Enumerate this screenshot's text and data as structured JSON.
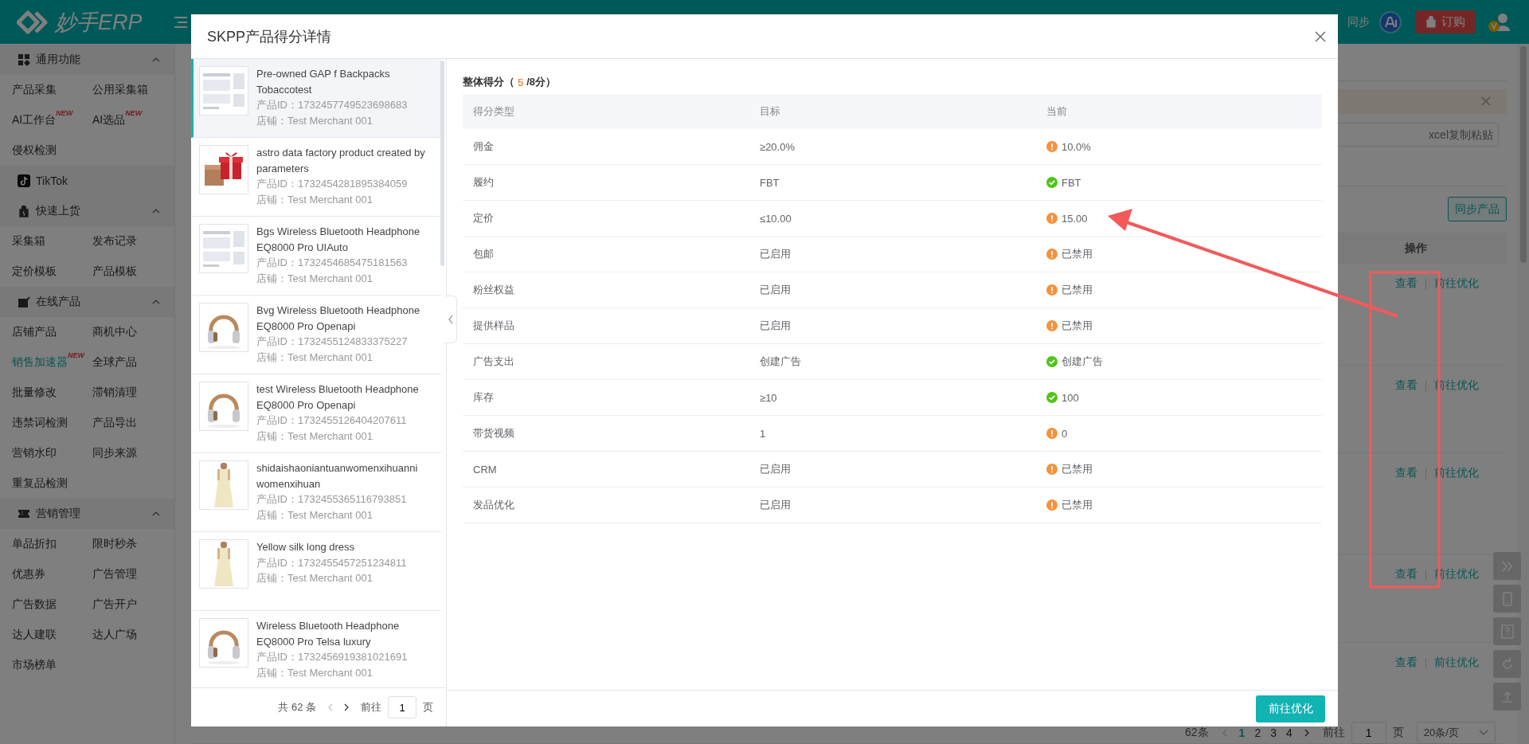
{
  "topbar": {
    "logo": "妙手ERP",
    "sync": "同步",
    "order_button": "订购"
  },
  "sidebar": {
    "sections": [
      {
        "title": "通用功能",
        "expanded": true,
        "items": [
          {
            "label": "产品采集",
            "selected": false
          },
          {
            "label": "公用采集箱",
            "selected": false
          },
          {
            "label": "AI工作台",
            "selected": false,
            "badge": "NEW"
          },
          {
            "label": "AI选品",
            "selected": false,
            "badge": "NEW"
          },
          {
            "label": "侵权检测",
            "selected": false
          }
        ]
      },
      {
        "title": "TikTok"
      },
      {
        "title": "快速上货",
        "expanded": true,
        "items": [
          {
            "label": "采集箱",
            "selected": false
          },
          {
            "label": "发布记录",
            "selected": false
          },
          {
            "label": "定价模板",
            "selected": false
          },
          {
            "label": "产品模板",
            "selected": false
          }
        ]
      },
      {
        "title": "在线产品",
        "expanded": true,
        "items": [
          {
            "label": "店铺产品",
            "selected": false
          },
          {
            "label": "商机中心",
            "selected": false
          },
          {
            "label": "销售加速器",
            "selected": true,
            "badge": "NEW"
          },
          {
            "label": "全球产品",
            "selected": false
          },
          {
            "label": "批量修改",
            "selected": false
          },
          {
            "label": "滞销清理",
            "selected": false
          },
          {
            "label": "违禁词检测",
            "selected": false
          },
          {
            "label": "产品导出",
            "selected": false
          },
          {
            "label": "营销水印",
            "selected": false
          },
          {
            "label": "同步来源",
            "selected": false
          },
          {
            "label": "重复品检测",
            "selected": false
          }
        ]
      },
      {
        "title": "营销管理",
        "expanded": true,
        "items": [
          {
            "label": "单品折扣",
            "selected": false
          },
          {
            "label": "限时秒杀",
            "selected": false
          },
          {
            "label": "优惠券",
            "selected": false
          },
          {
            "label": "广告管理",
            "selected": false
          },
          {
            "label": "广告数据",
            "selected": false
          },
          {
            "label": "广告开户",
            "selected": false
          },
          {
            "label": "达人建联",
            "selected": false
          },
          {
            "label": "达人广场",
            "selected": false
          },
          {
            "label": "市场榜单",
            "selected": false
          }
        ]
      }
    ]
  },
  "page": {
    "search_placeholder": "xcel复制粘贴",
    "sync_products_button": "同步产品",
    "action_column": "操作",
    "rows": [
      {
        "actions": [
          "查看",
          "前往优化"
        ]
      },
      {
        "actions": [
          "查看",
          "前往优化"
        ]
      },
      {
        "actions": [
          "查看",
          "前往优化"
        ]
      },
      {
        "actions": [
          "查看",
          "前往优化"
        ]
      },
      {
        "actions": [
          "查看",
          "前往优化"
        ]
      }
    ],
    "pagination": {
      "total": "62条",
      "pages": [
        {
          "label": "1",
          "selected": true
        },
        {
          "label": "2",
          "selected": false
        },
        {
          "label": "3",
          "selected": false
        },
        {
          "label": "4",
          "selected": false
        }
      ],
      "goto": "前往",
      "page_input": "1",
      "page_unit": "页",
      "page_size": "20条/页"
    }
  },
  "modal": {
    "title": "SKPP产品得分详情",
    "products": [
      {
        "name": "Pre-owned GAP f Backpacks Tobaccotest",
        "id": "产品ID：1732457749523698683",
        "shop": "店铺：Test Merchant 001",
        "selected": true
      },
      {
        "name": "astro data factory product created by parameters",
        "id": "产品ID：1732454281895384059",
        "shop": "店铺：Test Merchant 001",
        "selected": false
      },
      {
        "name": "Bgs Wireless Bluetooth Headphone EQ8000 Pro UIAuto",
        "id": "产品ID：1732454685475181563",
        "shop": "店铺：Test Merchant 001",
        "selected": false
      },
      {
        "name": "Bvg Wireless Bluetooth Headphone EQ8000 Pro Openapi",
        "id": "产品ID：1732455124833375227",
        "shop": "店铺：Test Merchant 001",
        "selected": false
      },
      {
        "name": "test Wireless Bluetooth Headphone EQ8000 Pro Openapi",
        "id": "产品ID：1732455126404207611",
        "shop": "店铺：Test Merchant 001",
        "selected": false
      },
      {
        "name": "shidaishaoniantuanwomenxihuanni womenxihuan",
        "id": "产品ID：1732455365116793851",
        "shop": "店铺：Test Merchant 001",
        "selected": false
      },
      {
        "name": "Yellow silk long dress",
        "id": "产品ID：1732455457251234811",
        "shop": "店铺：Test Merchant 001",
        "selected": false
      },
      {
        "name": "Wireless Bluetooth Headphone EQ8000 Pro Telsa luxury",
        "id": "产品ID：1732456919381021691",
        "shop": "店铺：Test Merchant 001",
        "selected": false
      }
    ],
    "list_pagination": {
      "total": "共 62 条",
      "goto": "前往",
      "page_input": "1",
      "page_unit": "页"
    },
    "score": {
      "label": "整体得分（",
      "value": "5",
      "total": "/8分）"
    },
    "columns": [
      "得分类型",
      "目标",
      "当前"
    ],
    "rows": [
      {
        "type": "佣金",
        "target": "≥20.0%",
        "current": "10.0%",
        "kind": "warn"
      },
      {
        "type": "履约",
        "target": "FBT",
        "current": "FBT",
        "kind": "ok"
      },
      {
        "type": "定价",
        "target": "≤10.00",
        "current": "15.00",
        "kind": "warn"
      },
      {
        "type": "包邮",
        "target": "已启用",
        "current": "已禁用",
        "kind": "warn"
      },
      {
        "type": "粉丝权益",
        "target": "已启用",
        "current": "已禁用",
        "kind": "warn"
      },
      {
        "type": "提供样品",
        "target": "已启用",
        "current": "已禁用",
        "kind": "warn"
      },
      {
        "type": "广告支出",
        "target": "创建广告",
        "current": "创建广告",
        "kind": "ok"
      },
      {
        "type": "库存",
        "target": "≥10",
        "current": "100",
        "kind": "ok"
      },
      {
        "type": "带货视频",
        "target": "1",
        "current": "0",
        "kind": "warn"
      },
      {
        "type": "CRM",
        "target": "已启用",
        "current": "已禁用",
        "kind": "warn"
      },
      {
        "type": "发品优化",
        "target": "已启用",
        "current": "已禁用",
        "kind": "warn"
      }
    ],
    "primary_button": "前往优化"
  }
}
